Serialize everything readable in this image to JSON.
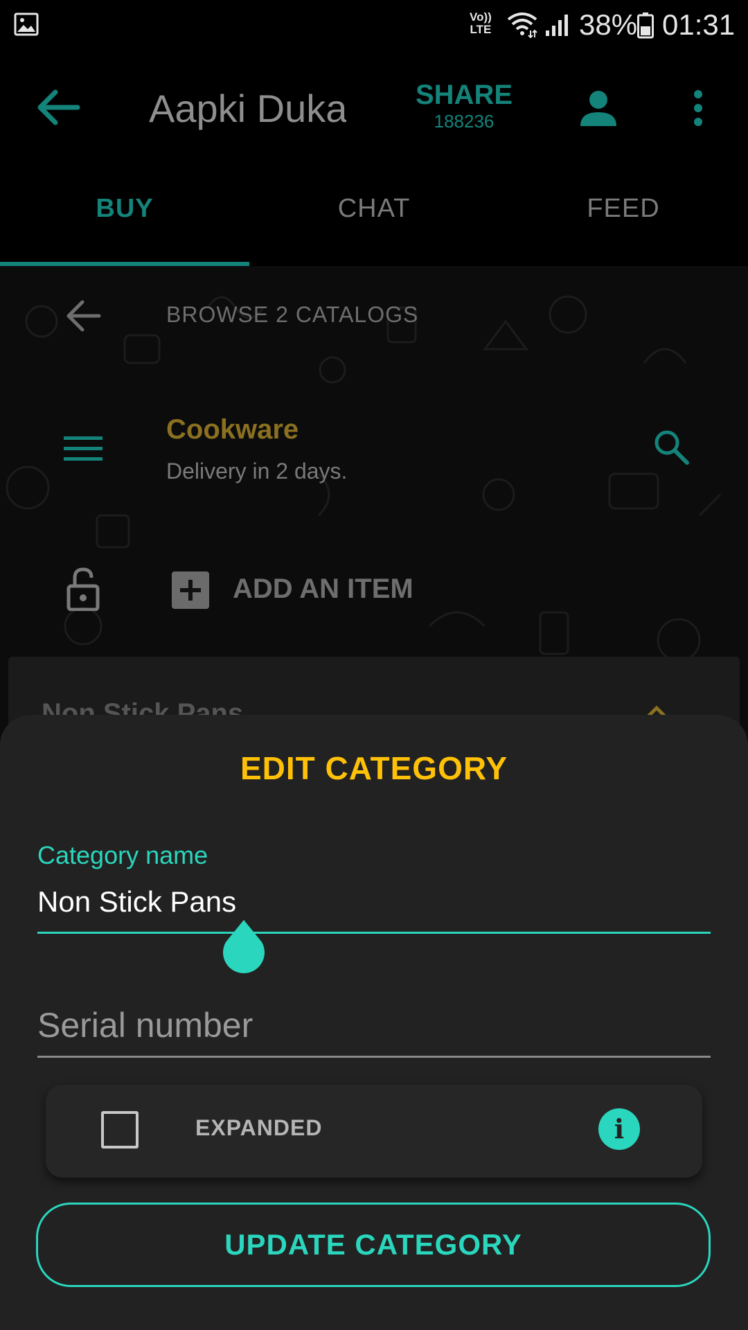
{
  "status_bar": {
    "volte_top": "Vo))",
    "volte_bottom": "LTE",
    "battery_percent": "38%",
    "time": "01:31",
    "icons": [
      "gallery-icon",
      "wifi-icon",
      "signal-icon",
      "battery-icon"
    ]
  },
  "app_bar": {
    "title": "Aapki Duka",
    "share_label": "SHARE",
    "share_count": "188236",
    "icons": [
      "back-arrow-icon",
      "person-icon",
      "more-vert-icon"
    ]
  },
  "tabs": [
    {
      "label": "BUY",
      "selected": true
    },
    {
      "label": "CHAT",
      "selected": false
    },
    {
      "label": "FEED",
      "selected": false
    }
  ],
  "catalog": {
    "browse_label": "BROWSE 2 CATALOGS",
    "title": "Cookware",
    "subtitle": "Delivery in 2 days.",
    "add_item_label": "ADD AN ITEM",
    "category_row_title": "Non Stick Pans"
  },
  "sheet": {
    "title": "EDIT CATEGORY",
    "category_name_label": "Category name",
    "category_name_value": "Non Stick Pans",
    "serial_placeholder": "Serial number",
    "expanded_label": "EXPANDED",
    "expanded_checked": false,
    "info_glyph": "i",
    "update_button_label": "UPDATE CATEGORY"
  },
  "colors": {
    "accent_teal": "#2ad6bd",
    "dark_teal": "#14837a",
    "title_yellow": "#ffc107",
    "catalog_gold": "#8a7020",
    "sheet_bg": "#222222"
  }
}
